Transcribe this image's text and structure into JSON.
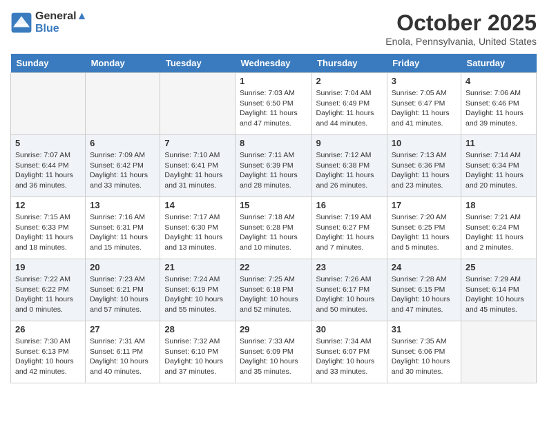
{
  "logo": {
    "line1": "General",
    "line2": "Blue"
  },
  "title": "October 2025",
  "location": "Enola, Pennsylvania, United States",
  "days_of_week": [
    "Sunday",
    "Monday",
    "Tuesday",
    "Wednesday",
    "Thursday",
    "Friday",
    "Saturday"
  ],
  "weeks": [
    [
      {
        "date": "",
        "sunrise": "",
        "sunset": "",
        "daylight": ""
      },
      {
        "date": "",
        "sunrise": "",
        "sunset": "",
        "daylight": ""
      },
      {
        "date": "",
        "sunrise": "",
        "sunset": "",
        "daylight": ""
      },
      {
        "date": "1",
        "sunrise": "Sunrise: 7:03 AM",
        "sunset": "Sunset: 6:50 PM",
        "daylight": "Daylight: 11 hours and 47 minutes."
      },
      {
        "date": "2",
        "sunrise": "Sunrise: 7:04 AM",
        "sunset": "Sunset: 6:49 PM",
        "daylight": "Daylight: 11 hours and 44 minutes."
      },
      {
        "date": "3",
        "sunrise": "Sunrise: 7:05 AM",
        "sunset": "Sunset: 6:47 PM",
        "daylight": "Daylight: 11 hours and 41 minutes."
      },
      {
        "date": "4",
        "sunrise": "Sunrise: 7:06 AM",
        "sunset": "Sunset: 6:46 PM",
        "daylight": "Daylight: 11 hours and 39 minutes."
      }
    ],
    [
      {
        "date": "5",
        "sunrise": "Sunrise: 7:07 AM",
        "sunset": "Sunset: 6:44 PM",
        "daylight": "Daylight: 11 hours and 36 minutes."
      },
      {
        "date": "6",
        "sunrise": "Sunrise: 7:09 AM",
        "sunset": "Sunset: 6:42 PM",
        "daylight": "Daylight: 11 hours and 33 minutes."
      },
      {
        "date": "7",
        "sunrise": "Sunrise: 7:10 AM",
        "sunset": "Sunset: 6:41 PM",
        "daylight": "Daylight: 11 hours and 31 minutes."
      },
      {
        "date": "8",
        "sunrise": "Sunrise: 7:11 AM",
        "sunset": "Sunset: 6:39 PM",
        "daylight": "Daylight: 11 hours and 28 minutes."
      },
      {
        "date": "9",
        "sunrise": "Sunrise: 7:12 AM",
        "sunset": "Sunset: 6:38 PM",
        "daylight": "Daylight: 11 hours and 26 minutes."
      },
      {
        "date": "10",
        "sunrise": "Sunrise: 7:13 AM",
        "sunset": "Sunset: 6:36 PM",
        "daylight": "Daylight: 11 hours and 23 minutes."
      },
      {
        "date": "11",
        "sunrise": "Sunrise: 7:14 AM",
        "sunset": "Sunset: 6:34 PM",
        "daylight": "Daylight: 11 hours and 20 minutes."
      }
    ],
    [
      {
        "date": "12",
        "sunrise": "Sunrise: 7:15 AM",
        "sunset": "Sunset: 6:33 PM",
        "daylight": "Daylight: 11 hours and 18 minutes."
      },
      {
        "date": "13",
        "sunrise": "Sunrise: 7:16 AM",
        "sunset": "Sunset: 6:31 PM",
        "daylight": "Daylight: 11 hours and 15 minutes."
      },
      {
        "date": "14",
        "sunrise": "Sunrise: 7:17 AM",
        "sunset": "Sunset: 6:30 PM",
        "daylight": "Daylight: 11 hours and 13 minutes."
      },
      {
        "date": "15",
        "sunrise": "Sunrise: 7:18 AM",
        "sunset": "Sunset: 6:28 PM",
        "daylight": "Daylight: 11 hours and 10 minutes."
      },
      {
        "date": "16",
        "sunrise": "Sunrise: 7:19 AM",
        "sunset": "Sunset: 6:27 PM",
        "daylight": "Daylight: 11 hours and 7 minutes."
      },
      {
        "date": "17",
        "sunrise": "Sunrise: 7:20 AM",
        "sunset": "Sunset: 6:25 PM",
        "daylight": "Daylight: 11 hours and 5 minutes."
      },
      {
        "date": "18",
        "sunrise": "Sunrise: 7:21 AM",
        "sunset": "Sunset: 6:24 PM",
        "daylight": "Daylight: 11 hours and 2 minutes."
      }
    ],
    [
      {
        "date": "19",
        "sunrise": "Sunrise: 7:22 AM",
        "sunset": "Sunset: 6:22 PM",
        "daylight": "Daylight: 11 hours and 0 minutes."
      },
      {
        "date": "20",
        "sunrise": "Sunrise: 7:23 AM",
        "sunset": "Sunset: 6:21 PM",
        "daylight": "Daylight: 10 hours and 57 minutes."
      },
      {
        "date": "21",
        "sunrise": "Sunrise: 7:24 AM",
        "sunset": "Sunset: 6:19 PM",
        "daylight": "Daylight: 10 hours and 55 minutes."
      },
      {
        "date": "22",
        "sunrise": "Sunrise: 7:25 AM",
        "sunset": "Sunset: 6:18 PM",
        "daylight": "Daylight: 10 hours and 52 minutes."
      },
      {
        "date": "23",
        "sunrise": "Sunrise: 7:26 AM",
        "sunset": "Sunset: 6:17 PM",
        "daylight": "Daylight: 10 hours and 50 minutes."
      },
      {
        "date": "24",
        "sunrise": "Sunrise: 7:28 AM",
        "sunset": "Sunset: 6:15 PM",
        "daylight": "Daylight: 10 hours and 47 minutes."
      },
      {
        "date": "25",
        "sunrise": "Sunrise: 7:29 AM",
        "sunset": "Sunset: 6:14 PM",
        "daylight": "Daylight: 10 hours and 45 minutes."
      }
    ],
    [
      {
        "date": "26",
        "sunrise": "Sunrise: 7:30 AM",
        "sunset": "Sunset: 6:13 PM",
        "daylight": "Daylight: 10 hours and 42 minutes."
      },
      {
        "date": "27",
        "sunrise": "Sunrise: 7:31 AM",
        "sunset": "Sunset: 6:11 PM",
        "daylight": "Daylight: 10 hours and 40 minutes."
      },
      {
        "date": "28",
        "sunrise": "Sunrise: 7:32 AM",
        "sunset": "Sunset: 6:10 PM",
        "daylight": "Daylight: 10 hours and 37 minutes."
      },
      {
        "date": "29",
        "sunrise": "Sunrise: 7:33 AM",
        "sunset": "Sunset: 6:09 PM",
        "daylight": "Daylight: 10 hours and 35 minutes."
      },
      {
        "date": "30",
        "sunrise": "Sunrise: 7:34 AM",
        "sunset": "Sunset: 6:07 PM",
        "daylight": "Daylight: 10 hours and 33 minutes."
      },
      {
        "date": "31",
        "sunrise": "Sunrise: 7:35 AM",
        "sunset": "Sunset: 6:06 PM",
        "daylight": "Daylight: 10 hours and 30 minutes."
      },
      {
        "date": "",
        "sunrise": "",
        "sunset": "",
        "daylight": ""
      }
    ]
  ]
}
